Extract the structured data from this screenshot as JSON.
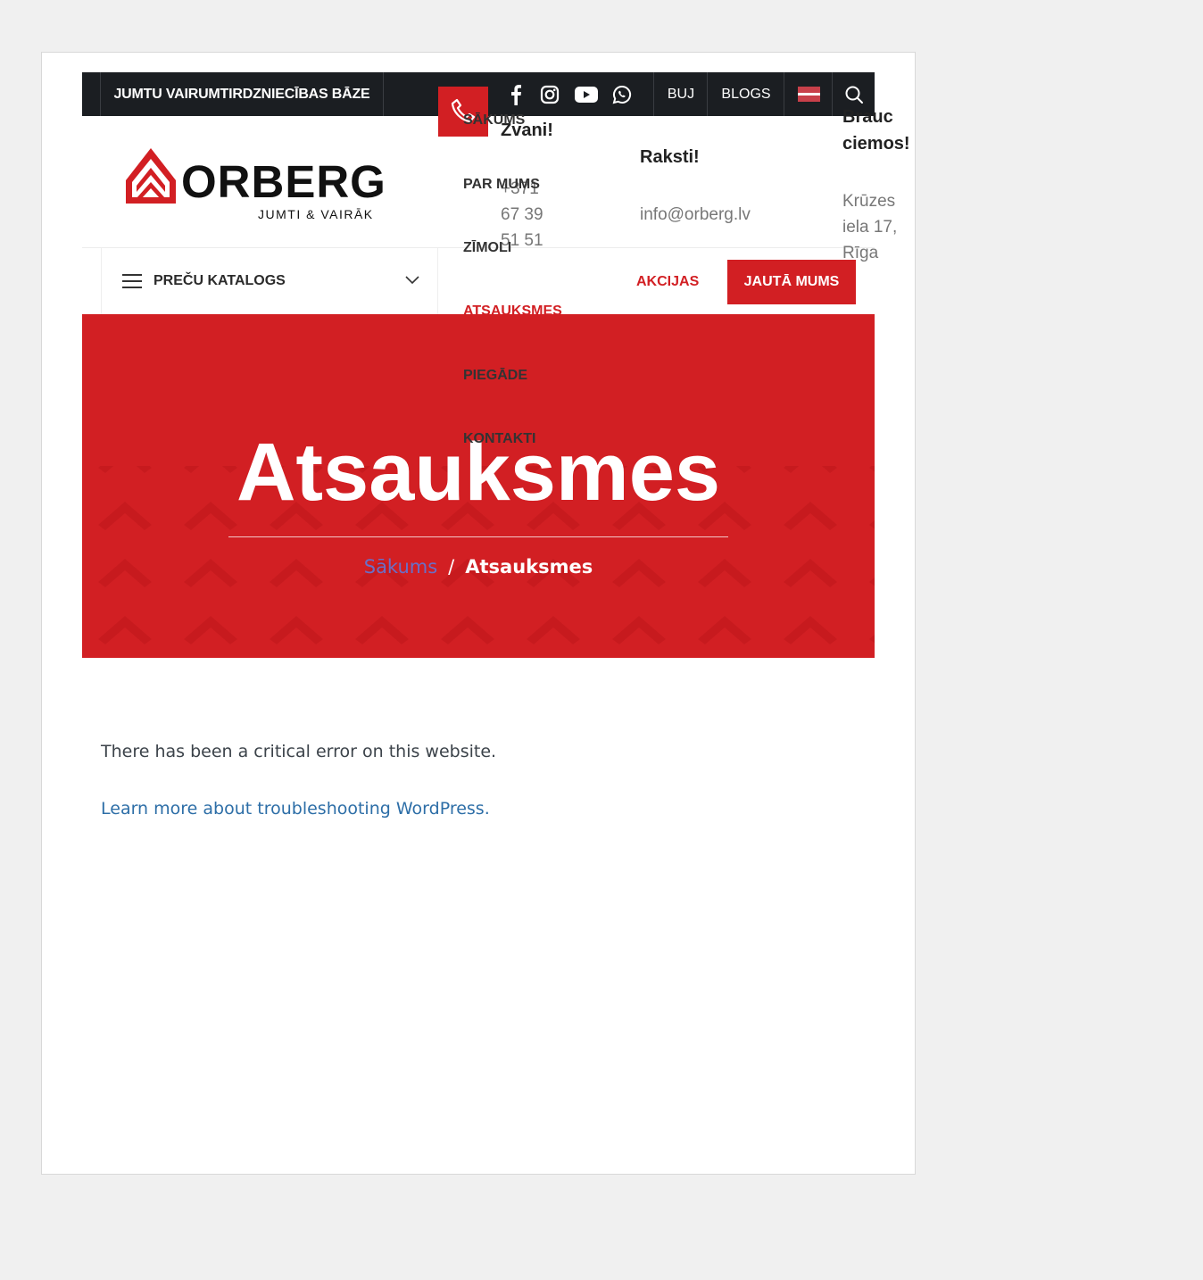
{
  "topbar": {
    "tagline": "JUMTU VAIRUMTIRDZNIECĪBAS BĀZE",
    "social_icons": [
      "facebook-icon",
      "instagram-icon",
      "youtube-icon",
      "whatsapp-icon"
    ],
    "links": [
      "BUJ",
      "BLOGS"
    ],
    "flag_colors": [
      "#c8404a",
      "#ffffff",
      "#c8404a"
    ],
    "search_icon": "search-icon"
  },
  "logo": {
    "brand": "ORBERG",
    "tagline": "JUMTI & VAIRĀK"
  },
  "menu": {
    "items": [
      "SĀKUMS",
      "PAR MUMS",
      "ZĪMOLI",
      "ATSAUKSMES",
      "PIEGĀDE",
      "KONTAKTI"
    ],
    "active_index": 3
  },
  "contacts": {
    "call": {
      "title": "Zvani!",
      "value_lines": [
        "+371",
        "67 39",
        "51 51"
      ]
    },
    "write": {
      "title": "Raksti!",
      "value": "info@orberg.lv"
    },
    "visit": {
      "title_lines": [
        "Brauc",
        "ciemos!"
      ],
      "value_lines": [
        "Krūzes",
        "iela 17,",
        "Rīga"
      ]
    }
  },
  "catalog": {
    "label": "PREČU KATALOGS"
  },
  "actions": {
    "akcijas": "AKCIJAS",
    "ask": "JAUTĀ MUMS"
  },
  "hero": {
    "title": "Atsauksmes",
    "breadcrumb": {
      "home": "Sākums",
      "separator": "/",
      "current": "Atsauksmes"
    }
  },
  "error": {
    "message": "There has been a critical error on this website.",
    "link": "Learn more about troubleshooting WordPress."
  },
  "colors": {
    "brand_red": "#d21f23",
    "topbar": "#1b1e22",
    "link_blue": "#2d6ea7"
  }
}
